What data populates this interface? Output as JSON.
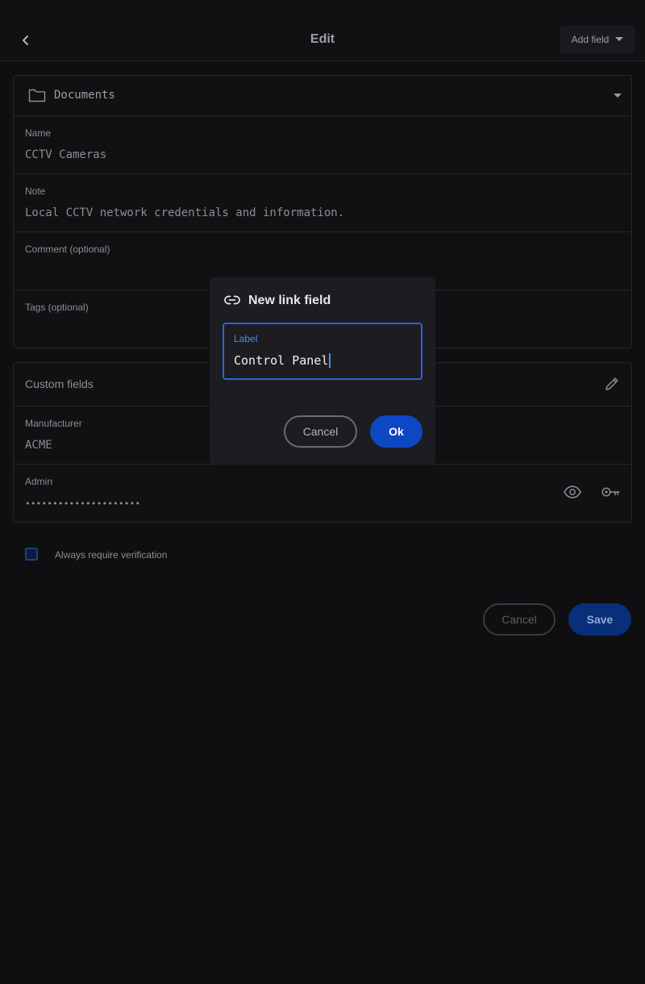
{
  "header": {
    "title": "Edit",
    "back_icon": "chevron-left-icon",
    "add_field_label": "Add field"
  },
  "folder": {
    "icon": "folder-icon",
    "name": "Documents"
  },
  "fields": {
    "name": {
      "label": "Name",
      "value": "CCTV Cameras"
    },
    "note": {
      "label": "Note",
      "value": "Local CCTV network credentials and information."
    },
    "comment": {
      "label": "Comment (optional)",
      "value": ""
    },
    "tags": {
      "label": "Tags (optional)",
      "value": ""
    }
  },
  "custom_fields": {
    "title": "Custom fields",
    "items": [
      {
        "label": "Manufacturer",
        "value": "ACME"
      },
      {
        "label": "Admin",
        "value": "•••••••••••••••••••••"
      }
    ]
  },
  "verification": {
    "label": "Always require verification",
    "checked": false
  },
  "footer": {
    "cancel_label": "Cancel",
    "save_label": "Save"
  },
  "dialog": {
    "title": "New link field",
    "icon": "link-icon",
    "input_label": "Label",
    "input_value": "Control Panel",
    "cancel_label": "Cancel",
    "ok_label": "Ok"
  },
  "colors": {
    "background": "#0f0f11",
    "accent": "#0d47c4",
    "accent_dim": "#0a2f79",
    "dialog_bg": "#1c1c21"
  }
}
